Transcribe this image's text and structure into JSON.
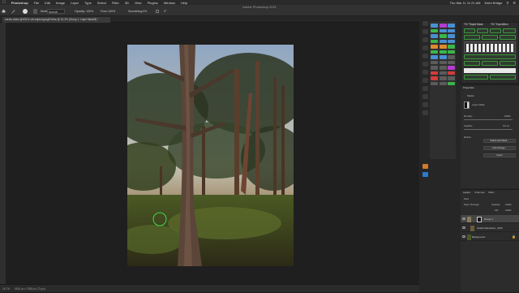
{
  "menubar": {
    "apple": "",
    "app_name": "Photoshop",
    "items": [
      "File",
      "Edit",
      "Image",
      "Layer",
      "Type",
      "Select",
      "Filter",
      "3D",
      "View",
      "Plugins",
      "Window",
      "Help"
    ],
    "clock": "Thu Mar 11  11:21 AM",
    "user": "Eden Bridge"
  },
  "window_title": "Adobe Photoshop 2021",
  "options": {
    "mode_label": "Mode:",
    "mode_value": "Normal",
    "opacity_label": "Opacity:",
    "opacity_value": "100%",
    "flow_label": "Flow:",
    "flow_value": "100%",
    "smoothing_label": "Smoothing:",
    "smoothing_value": "0%",
    "angle_value": "0°"
  },
  "document_tab": {
    "title": "eerste-tokke-@00011-wit-snipbot.jpeg/Follow @ 16.2% (Group 1, Layer Mask/8) *"
  },
  "status": {
    "zoom": "16.7%",
    "dimensions": "5616 px x 7488 px (72 ppi)"
  },
  "extension_panel": {
    "buttons": [
      {
        "label": "",
        "color": "#4a8fd1"
      },
      {
        "label": "",
        "color": "#b23ccf"
      },
      {
        "label": "",
        "color": "#4a8fd1"
      },
      {
        "label": "",
        "color": "#3bb54a"
      },
      {
        "label": "",
        "color": "#4a8fd1"
      },
      {
        "label": "",
        "color": "#4a8fd1"
      },
      {
        "label": "",
        "color": "#4a8fd1"
      },
      {
        "label": "",
        "color": "#3bb54a"
      },
      {
        "label": "",
        "color": "#4a8fd1"
      },
      {
        "label": "",
        "color": "#3bb54a"
      },
      {
        "label": "",
        "color": "#4a8fd1"
      },
      {
        "label": "",
        "color": "#4a8fd1"
      },
      {
        "label": "",
        "color": "#e08a2d"
      },
      {
        "label": "",
        "color": "#e08a2d"
      },
      {
        "label": "",
        "color": "#3bb54a"
      },
      {
        "label": "",
        "color": "#3bb54a"
      },
      {
        "label": "",
        "color": "#3bb54a"
      },
      {
        "label": "",
        "color": "#3bb54a"
      },
      {
        "label": "",
        "color": "#4a8fd1"
      },
      {
        "label": "",
        "color": "#4a8fd1"
      },
      {
        "label": "",
        "color": "#5b5b5b"
      },
      {
        "label": "",
        "color": "#5b5b5b"
      },
      {
        "label": "",
        "color": "#5b5b5b"
      },
      {
        "label": "",
        "color": "#5b5b5b"
      },
      {
        "label": "",
        "color": "#5b5b5b"
      },
      {
        "label": "",
        "color": "#5b5b5b"
      },
      {
        "label": "",
        "color": "#b23ccf"
      },
      {
        "label": "",
        "color": "#d23c3c"
      },
      {
        "label": "",
        "color": "#5b5b5b"
      },
      {
        "label": "",
        "color": "#d23c3c"
      },
      {
        "label": "",
        "color": "#d23c3c"
      },
      {
        "label": "",
        "color": "#5b5b5b"
      },
      {
        "label": "",
        "color": "#5b5b5b"
      },
      {
        "label": "",
        "color": "#5b5b5b"
      },
      {
        "label": "",
        "color": "#5b5b5b"
      },
      {
        "label": "",
        "color": "#3bb54a"
      }
    ]
  },
  "rich_panel": {
    "title": "TK7 Rapid Mask",
    "tab2": "TK7 Expedition"
  },
  "properties": {
    "title": "Properties",
    "subtitle": "Masks",
    "mask_label": "Layer Mask",
    "density_label": "Density:",
    "density_value": "100%",
    "feather_label": "Feather:",
    "feather_value": "0.0 px",
    "refine_label": "Refine:",
    "select_mask": "Select and Mask...",
    "color_range": "Color Range...",
    "invert": "Invert"
  },
  "layers": {
    "tabs": [
      "Layers",
      "Channels",
      "Paths"
    ],
    "kind_label": "Kind",
    "blend_mode": "Pass Through",
    "opacity_label": "Opacity:",
    "opacity_value": "100%",
    "fill_label": "Fill:",
    "fill_value": "100%",
    "rows": [
      {
        "name": "Group 1"
      },
      {
        "name": "Global Saturation: (CPF"
      },
      {
        "name": "Background"
      }
    ]
  }
}
